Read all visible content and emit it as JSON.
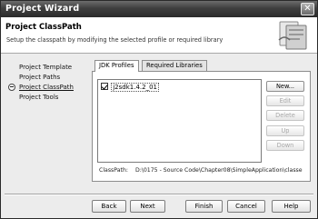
{
  "window": {
    "title": "Project Wizard",
    "close_glyph": "✕"
  },
  "header": {
    "title": "Project ClassPath",
    "subtitle": "Setup the classpath by modifying the selected profile or required library",
    "icon": "wizard-pages-icon"
  },
  "nav": {
    "items": [
      {
        "label": "Project Template",
        "active": false
      },
      {
        "label": "Project Paths",
        "active": false
      },
      {
        "label": "Project ClassPath",
        "active": true
      },
      {
        "label": "Project Tools",
        "active": false
      }
    ]
  },
  "tabs": [
    {
      "label": "JDK Profiles",
      "active": true
    },
    {
      "label": "Required Libraries",
      "active": false
    }
  ],
  "jdk_list": {
    "items": [
      {
        "label": "j2sdk1.4.2_01",
        "checked": true
      }
    ]
  },
  "side_buttons": {
    "new": "New...",
    "edit": "Edit",
    "delete": "Delete",
    "up": "Up",
    "down": "Down"
  },
  "classpath": {
    "label": "ClassPath:",
    "value": "D:\\0175 - Source Code\\Chapter08\\SimpleApplication\\classe"
  },
  "footer": {
    "back": "Back",
    "next": "Next",
    "finish": "Finish",
    "cancel": "Cancel",
    "help": "Help"
  }
}
